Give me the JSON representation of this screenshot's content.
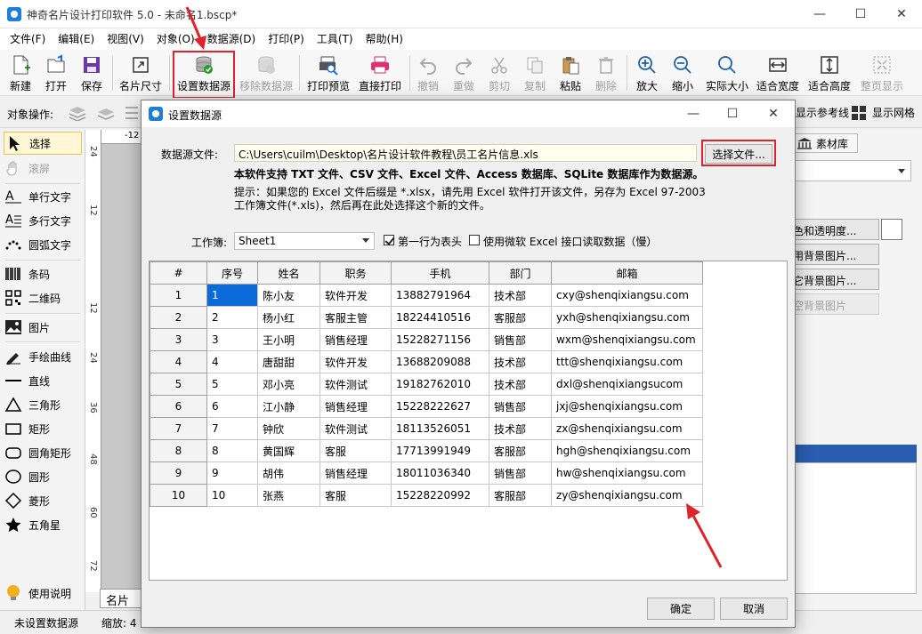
{
  "window": {
    "title": "神奇名片设计打印软件 5.0 - 未命名1.bscp*",
    "minimize": "—",
    "maximize": "☐",
    "close": "✕"
  },
  "menu": [
    "文件(F)",
    "编辑(E)",
    "视图(V)",
    "对象(O)",
    "数据源(D)",
    "打印(P)",
    "工具(T)",
    "帮助(H)"
  ],
  "toolbar": {
    "new": "新建",
    "open": "打开",
    "save": "保存",
    "card_size": "名片尺寸",
    "set_datasource": "设置数据源",
    "remove_datasource": "移除数据源",
    "print_preview": "打印预览",
    "direct_print": "直接打印",
    "undo": "撤销",
    "redo": "重做",
    "cut": "剪切",
    "copy": "复制",
    "paste": "粘贴",
    "delete": "删除",
    "zoom_in": "放大",
    "zoom_out": "缩小",
    "actual_size": "实际大小",
    "fit_width": "适合宽度",
    "fit_height": "适合高度",
    "full_page": "整页显示"
  },
  "objbar": {
    "label": "对象操作:",
    "show_guides": "显示参考线",
    "show_grid": "显示网格"
  },
  "leftpanel": {
    "select": "选择",
    "scroll": "滚屏",
    "single_text": "单行文字",
    "multi_text": "多行文字",
    "arc_text": "圆弧文字",
    "barcode": "条码",
    "qrcode": "二维码",
    "image": "图片",
    "freehand": "手绘曲线",
    "line": "直线",
    "triangle": "三角形",
    "rectangle": "矩形",
    "rounded_rect": "圆角矩形",
    "circle": "圆形",
    "diamond": "菱形",
    "star": "五角星",
    "help": "使用说明"
  },
  "ruler": {
    "top": "-12",
    "marks": [
      "24",
      "12",
      "12",
      "24",
      "36",
      "48",
      "60",
      "72"
    ]
  },
  "rightpanel": {
    "tab_material": "素材库",
    "color_alpha": "色和透明度...",
    "use_bg": "用背景图片...",
    "other_bg": "它背景图片...",
    "clear_bg": "空背景图片"
  },
  "statusbar": {
    "datasource": "未设置数据源",
    "zoom": "缩放: 4",
    "tab": "名片正"
  },
  "dialog": {
    "title": "设置数据源",
    "file_label": "数据源文件:",
    "file_path": "C:\\Users\\cuilm\\Desktop\\名片设计软件教程\\员工名片信息.xls",
    "choose_file": "选择文件...",
    "support_note": "本软件支持 TXT 文件、CSV 文件、Excel 文件、Access 数据库、SQLite 数据库作为数据源。",
    "hint": "提示：如果您的 Excel 文件后缀是 *.xlsx，请先用 Excel 软件打开该文件，另存为 Excel 97-2003 工作簿文件(*.xls)，然后再在此处选择这个新的文件。",
    "workbook_label": "工作簿:",
    "workbook_value": "Sheet1",
    "first_row_header": "第一行为表头",
    "use_ms_excel": "使用微软 Excel 接口读取数据（慢）",
    "ok": "确定",
    "cancel": "取消",
    "columns": [
      "#",
      "序号",
      "姓名",
      "职务",
      "手机",
      "部门",
      "邮箱"
    ],
    "rows": [
      [
        "1",
        "1",
        "陈小友",
        "软件开发",
        "13882791964",
        "技术部",
        "cxy@shenqixiangsu.com"
      ],
      [
        "2",
        "2",
        "杨小红",
        "客服主管",
        "18224410516",
        "客服部",
        "yxh@shenqixiangsu.com"
      ],
      [
        "3",
        "3",
        "王小明",
        "销售经理",
        "15228271156",
        "销售部",
        "wxm@shenqixiangsu.com"
      ],
      [
        "4",
        "4",
        "唐甜甜",
        "软件开发",
        "13688209088",
        "技术部",
        "ttt@shenqixiangsu.com"
      ],
      [
        "5",
        "5",
        "邓小亮",
        "软件测试",
        "19182762010",
        "技术部",
        "dxl@shenqixiangsucom"
      ],
      [
        "6",
        "6",
        "江小静",
        "销售经理",
        "15228222627",
        "销售部",
        "jxj@shenqixiangsu.com"
      ],
      [
        "7",
        "7",
        "钟欣",
        "软件测试",
        "18113526051",
        "技术部",
        "zx@shenqixiangsu.com"
      ],
      [
        "8",
        "8",
        "黄国辉",
        "客服",
        "17713991949",
        "客服部",
        "hgh@shenqixiangsu.com"
      ],
      [
        "9",
        "9",
        "胡伟",
        "销售经理",
        "18011036340",
        "销售部",
        "hw@shenqixiangsu.com"
      ],
      [
        "10",
        "10",
        "张燕",
        "客服",
        "15228220992",
        "客服部",
        "zy@shenqixiangsu.com"
      ]
    ]
  },
  "colors": {
    "accent_red": "#e0222a",
    "selection_blue": "#0a6ad8",
    "path_bg": "#fffff0"
  }
}
